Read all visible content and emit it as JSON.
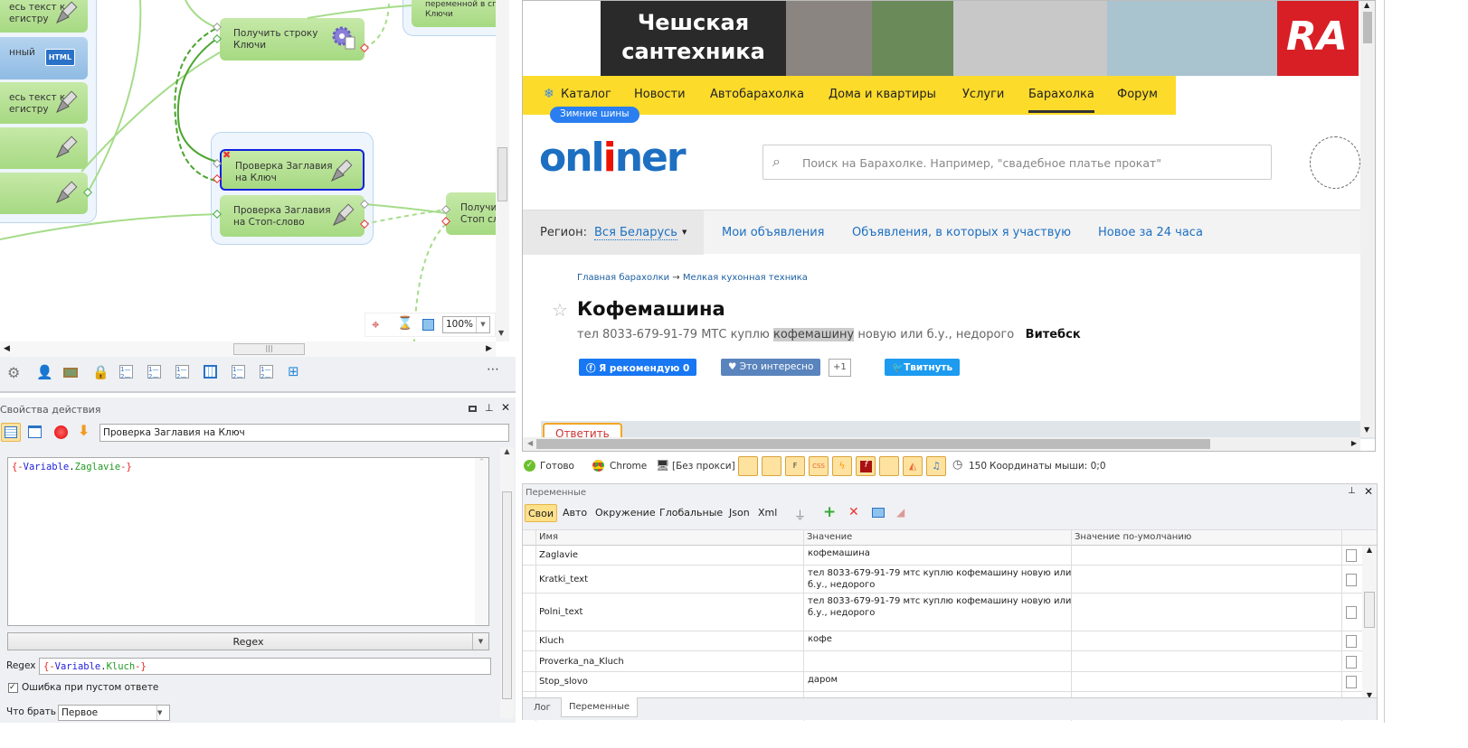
{
  "canvas": {
    "left_nodes": [
      "есь текст к\nегистру",
      "нный",
      "есь текст к\nегистру",
      "",
      ""
    ],
    "html_badge": "HTML",
    "node_get_keys": "Получить строку\nКлючи",
    "node_check_key": "Проверка Заглавия\nна Ключ",
    "node_check_stop": "Проверка Заглавия\nна Стоп-слово",
    "node_top_right": "переменной в спис\nКлючи",
    "node_right": "Получит\nСтоп сл",
    "zoom": "100%"
  },
  "props": {
    "title": "Свойства действия",
    "action_name": "Проверка Заглавия на Ключ",
    "input_text": {
      "open": "{-",
      "kw": "Variable",
      "dot": ".",
      "name": "Zaglavie",
      "close": "-}"
    },
    "mode": "Regex",
    "regex_label": "Regex",
    "regex_value": {
      "open": "{-",
      "kw": "Variable",
      "dot": ".",
      "name": "Kluch",
      "close": "-}"
    },
    "error_empty_label": "Ошибка при пустом ответе",
    "error_empty_checked": true,
    "take_label": "Что брать",
    "take_value": "Первое"
  },
  "browser": {
    "banner": {
      "title1": "Чешская",
      "title2": "сантехника",
      "brand": "RA"
    },
    "nav": [
      "Каталог",
      "Новости",
      "Автобарахолка",
      "Дома и квартиры",
      "Услуги",
      "Барахолка",
      "Форум"
    ],
    "nav_active": "Барахолка",
    "tag": "Зимние шины",
    "logo": {
      "a": "onl",
      "i": "i",
      "b": "ner"
    },
    "search_placeholder": "Поиск на Барахолке. Например, \"свадебное платье прокат\"",
    "region_label": "Регион:",
    "region_value": "Вся Беларусь",
    "links": [
      "Мои объявления",
      "Объявления, в которых я участвую",
      "Новое за 24 часа"
    ],
    "breadcrumb": [
      "Главная барахолки",
      "→",
      "Мелкая кухонная техника"
    ],
    "title": "Кофемашина",
    "desc_pre": "тел 8033-679-91-79 МТС куплю ",
    "desc_hl": "кофемашину",
    "desc_post": " новую или б.у., недорого",
    "city": "Витебск",
    "fb": "Я рекомендую 0",
    "interest": "Это интересно",
    "interest_count": "+1",
    "tweet": "Твитнуть",
    "reply": "Ответить"
  },
  "status": {
    "ready": "Готово",
    "browser": "Chrome",
    "proxy": "[Без прокси]",
    "count": "150",
    "coords": "Координаты мыши: 0;0"
  },
  "vars": {
    "title": "Переменные",
    "tabs": [
      "Свои",
      "Авто",
      "Окружение",
      "Глобальные",
      "Json",
      "Xml"
    ],
    "columns": [
      "Имя",
      "Значение",
      "Значение по-умолчанию"
    ],
    "rows": [
      {
        "name": "Zaglavie",
        "value": "кофемашина",
        "default": ""
      },
      {
        "name": "Kratki_text",
        "value": "тел 8033-679-91-79 мтс куплю кофемашину новую или\nб.у., недорого",
        "default": ""
      },
      {
        "name": "Polni_text",
        "value": "тел 8033-679-91-79 мтс куплю кофемашину новую или\nб.у., недорого",
        "default": ""
      },
      {
        "name": "Kluch",
        "value": "кофе",
        "default": ""
      },
      {
        "name": "Proverka_na_Kluch",
        "value": "",
        "default": ""
      },
      {
        "name": "Stop_slovo",
        "value": "даром",
        "default": ""
      }
    ]
  },
  "bottom_tabs": [
    "Лог",
    "Переменные"
  ]
}
